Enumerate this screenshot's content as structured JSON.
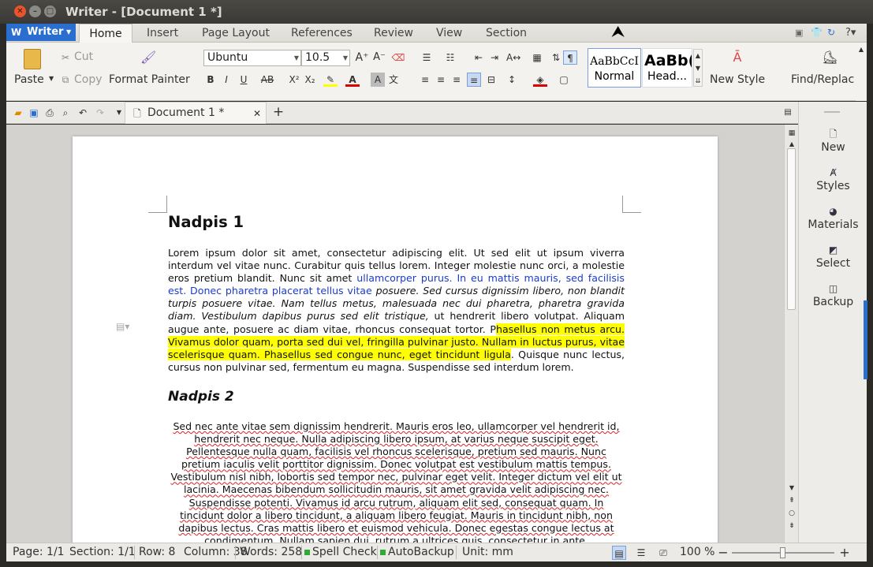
{
  "window": {
    "title": "Writer - [Document 1 *]"
  },
  "menu": {
    "app_label": "Writer",
    "tabs": [
      "Home",
      "Insert",
      "Page Layout",
      "References",
      "Review",
      "View",
      "Section"
    ]
  },
  "toolbar": {
    "paste": "Paste",
    "cut": "Cut",
    "copy": "Copy",
    "format_painter": "Format Painter",
    "font_name": "Ubuntu",
    "font_size": "10.5",
    "style_normal_preview": "AaBbCcI",
    "style_normal": "Normal",
    "style_heading_preview": "AaBb(",
    "style_heading": "Head...",
    "new_style": "New Style",
    "find_replace": "Find/Replac"
  },
  "doc_tab": {
    "label": "Document 1 *"
  },
  "document": {
    "heading1": "Nadpis 1",
    "p1": {
      "s1": "Lorem ipsum dolor sit amet, consectetur adipiscing elit. Ut sed elit ut ipsum viverra interdum vel vitae nunc. Curabitur quis tellus lorem. Integer molestie nunc orci, a molestie eros pretium blandit. Nunc sit amet ",
      "blue": "ullamcorper purus. In eu mattis mauris, sed facilisis est. Donec pharetra placerat tellus vitae",
      "italic": " posuere. Sed cursus dignissim libero, non blandit turpis posuere vitae. Nam tellus metus, malesuada nec dui pharetra, pharetra gravida diam. Vestibulum dapibus purus sed elit tristique,",
      "s2": " ut hendrerit libero volutpat. Aliquam augue ante, posuere ac diam vitae, rhoncus consequat tortor. P",
      "highlight": "hasellus non metus arcu. Vivamus dolor quam, porta sed dui vel, fringilla pulvinar justo. Nullam in luctus purus, vitae scelerisque quam. Phasellus sed congue nunc, eget tincidunt ligula",
      "s3": ". Quisque nunc lectus, cursus non pulvinar sed, fermentum eu magna. Suspendisse sed interdum lorem."
    },
    "heading2": "Nadpis 2",
    "p2": "Sed nec ante vitae sem dignissim hendrerit. Mauris eros leo, ullamcorper vel hendrerit id, hendrerit nec neque. Nulla adipiscing libero ipsum, at varius neque suscipit eget. Pellentesque nulla quam, facilisis vel rhoncus scelerisque, pretium sed mauris. Nunc pretium iaculis velit porttitor dignissim. Donec volutpat est vestibulum mattis tempus. Vestibulum nisl nibh, lobortis sed tempor nec, pulvinar eget velit. Integer dictum vel elit ut lacinia. Maecenas bibendum sollicitudin mauris, sit amet gravida velit adipiscing nec. Suspendisse potenti. Vivamus id arcu rutrum, aliquam elit sed, consequat quam. In tincidunt dolor a libero tincidunt, a aliquam libero feugiat. Mauris in tincidunt nibh, non dapibus lectus. Cras mattis libero et euismod vehicula. Donec egestas congue lectus at condimentum. Nullam sapien dui, rutrum a ultrices quis, consectetur in ante."
  },
  "sidebar": {
    "items": [
      "New",
      "Styles",
      "Materials",
      "Select",
      "Backup"
    ]
  },
  "status": {
    "page": "Page: 1/1",
    "section": "Section: 1/1",
    "row": "Row: 8",
    "column": "Column: 38",
    "words": "Words: 258",
    "spell": "Spell Check",
    "autobackup": "AutoBackup",
    "unit": "Unit: mm",
    "zoom": "100 %",
    "zoom_level": 0.5
  },
  "colors": {
    "highlight": "#ffff00",
    "link_blue": "#1a3ccc",
    "accent": "#2a6fd0"
  }
}
